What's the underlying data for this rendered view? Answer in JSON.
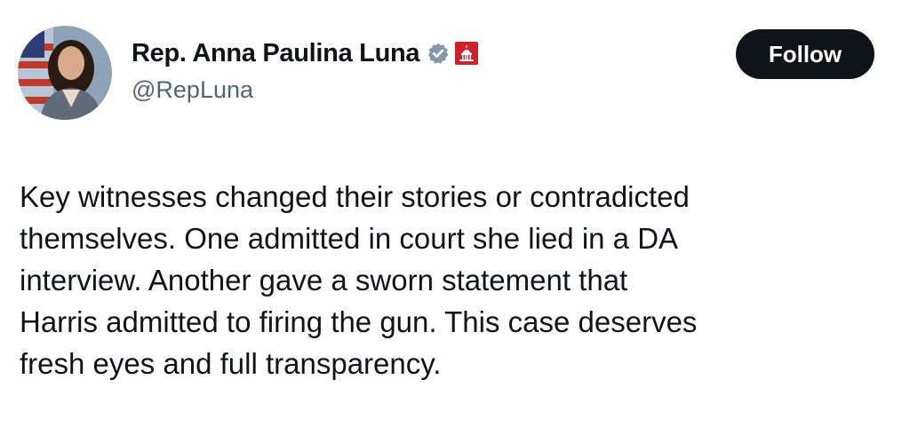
{
  "author": {
    "display_name": "Rep. Anna Paulina Luna",
    "handle": "@RepLuna",
    "avatar_icon": "profile-photo",
    "verified_icon": "verified-badge-icon",
    "verified_color": "#829aab",
    "affiliation_icon": "us-capitol-icon",
    "affiliation_color": "#d0202a"
  },
  "follow_button": {
    "label": "Follow",
    "background": "#0f1419",
    "text_color": "#ffffff"
  },
  "tweet": {
    "text": "Key witnesses changed their stories or contradicted\nthemselves. One admitted in court she lied in a DA\ninterview. Another gave a sworn statement that\nHarris admitted to firing the gun. This case deserves\nfresh eyes and full transparency."
  }
}
